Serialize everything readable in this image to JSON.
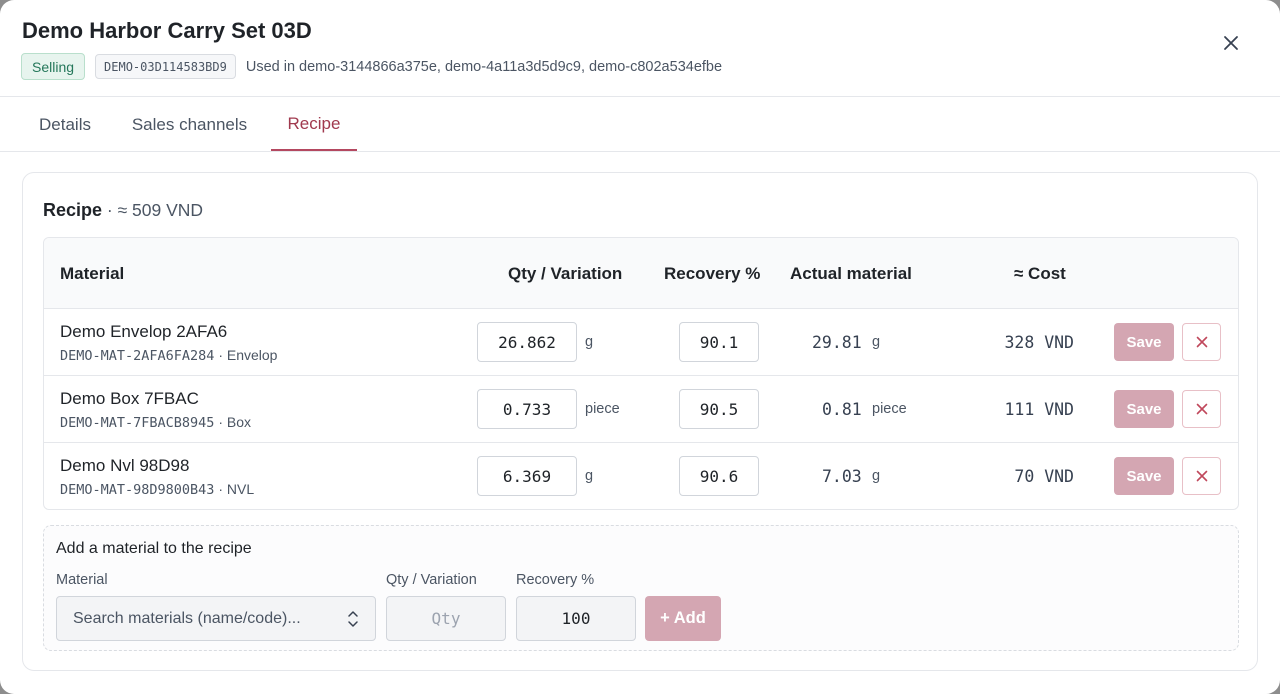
{
  "backdrop_text": "— ……",
  "header": {
    "title": "Demo Harbor Carry Set 03D",
    "status": "Selling",
    "code": "DEMO-03D114583BD9",
    "used_in": "Used in demo-3144866a375e, demo-4a11a3d5d9c9, demo-c802a534efbe"
  },
  "tabs": [
    {
      "label": "Details"
    },
    {
      "label": "Sales channels"
    },
    {
      "label": "Recipe",
      "active": true
    }
  ],
  "recipe": {
    "title": "Recipe",
    "cost_summary": " · ≈ 509 VND",
    "columns": {
      "material": "Material",
      "qty": "Qty / Variation",
      "recovery": "Recovery %",
      "actual": "Actual material",
      "cost": "≈ Cost"
    },
    "rows": [
      {
        "name": "Demo Envelop 2AFA6",
        "code": "DEMO-MAT-2AFA6FA284",
        "category": " · Envelop",
        "qty": "26.862",
        "unit": "g",
        "recovery": "90.1",
        "actual": "29.81",
        "actual_unit": "g",
        "cost": "328 VND",
        "save": "Save"
      },
      {
        "name": "Demo Box 7FBAC",
        "code": "DEMO-MAT-7FBACB8945",
        "category": " · Box",
        "qty": "0.733",
        "unit": "piece",
        "recovery": "90.5",
        "actual": "0.81",
        "actual_unit": "piece",
        "cost": "111 VND",
        "save": "Save"
      },
      {
        "name": "Demo Nvl 98D98",
        "code": "DEMO-MAT-98D9800B43",
        "category": " · NVL",
        "qty": "6.369",
        "unit": "g",
        "recovery": "90.6",
        "actual": "7.03",
        "actual_unit": "g",
        "cost": "70 VND",
        "save": "Save"
      }
    ]
  },
  "add_material": {
    "title": "Add a material to the recipe",
    "material_label": "Material",
    "material_placeholder": "Search materials (name/code)...",
    "qty_label": "Qty / Variation",
    "qty_placeholder": "Qty",
    "recovery_label": "Recovery %",
    "recovery_value": "100",
    "add_label": "+ Add"
  },
  "colors": {
    "accent": "#a0394e",
    "button_disabled": "#d4a6b2",
    "status_green": "#24775a",
    "delete_red": "#c0485c"
  },
  "icons": {
    "close": "close-icon",
    "delete": "x-icon",
    "select": "chevron-updown-icon"
  }
}
